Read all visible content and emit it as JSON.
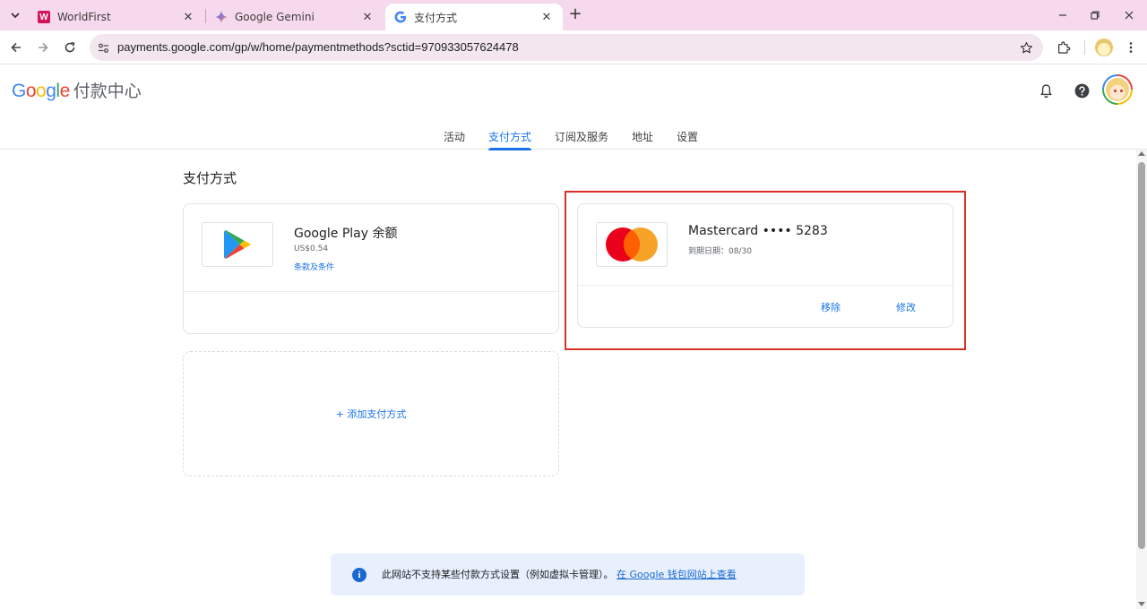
{
  "browser": {
    "tabs": [
      {
        "title": "WorldFirst",
        "icon": "worldfirst-logo",
        "logo_letter": "W"
      },
      {
        "title": "Google Gemini",
        "icon": "gemini-icon"
      },
      {
        "title": "支付方式",
        "icon": "google-g-icon",
        "active": true
      }
    ],
    "new_tab": "+",
    "url": "payments.google.com/gp/w/home/paymentmethods?sctid=970933057624478"
  },
  "header": {
    "brand": "Google",
    "product": "付款中心"
  },
  "nav": {
    "tabs": [
      {
        "label": "活动"
      },
      {
        "label": "支付方式",
        "active": true
      },
      {
        "label": "订阅及服务"
      },
      {
        "label": "地址"
      },
      {
        "label": "设置"
      }
    ]
  },
  "main": {
    "heading": "支付方式",
    "methods": [
      {
        "name": "Google Play 余额",
        "balance": "US$0.54",
        "link": "条款及条件",
        "icon": "google-play-icon"
      },
      {
        "name": "Mastercard •••• 5283",
        "expiry": "到期日期：08/30",
        "actions": {
          "remove": "移除",
          "edit": "修改"
        },
        "icon": "mastercard-logo"
      }
    ],
    "add_method": "+ 添加支付方式"
  },
  "banner": {
    "message": "此网站不支持某些付款方式设置（例如虚拟卡管理）。",
    "link": "在 Google 钱包网站上查看"
  },
  "colors": {
    "accent": "#1a73e8",
    "highlight": "#d93025",
    "tab_strip": "#f6d9ec",
    "banner_bg": "#e8f0fe"
  }
}
